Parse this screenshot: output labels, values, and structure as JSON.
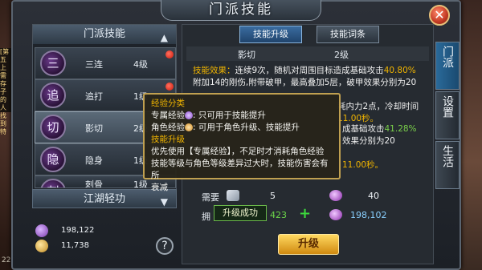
{
  "window": {
    "title": "门派技能",
    "close_label": "✕"
  },
  "left": {
    "header": "门派技能",
    "skills": [
      {
        "icon": "三",
        "name": "三连",
        "level": "4级",
        "red_dot": true
      },
      {
        "icon": "追",
        "name": "追打",
        "level": "1级",
        "red_dot": true
      },
      {
        "icon": "切",
        "name": "影切",
        "level": "2级",
        "red_dot": false,
        "selected": true
      },
      {
        "icon": "隐",
        "name": "隐身",
        "level": "1级",
        "red_dot": false
      },
      {
        "icon": "刺",
        "name": "刺骨",
        "level": "1级",
        "red_dot": false
      }
    ],
    "footer": "江湖轻功",
    "currencies": [
      {
        "value": "198,122"
      },
      {
        "value": "11,738"
      }
    ],
    "help_label": "?"
  },
  "tabs": [
    {
      "label": "技能升级",
      "active": true
    },
    {
      "label": "技能词条",
      "active": false
    }
  ],
  "info": {
    "skill_name": "影切",
    "skill_level": "2级"
  },
  "desc": {
    "l1_a": "技能效果：",
    "l1_b": "连续9次，随机对周围目标造成基础攻击",
    "l1_c": "40.80%",
    "l2": "附加14的刚伤,附带破甲，最高叠加5层，破甲效果分别为20",
    "l3_tail": "耗内力2点，冷却时间",
    "l3_val": "11.00秒。",
    "l4_tail": "成基础攻击",
    "l4_val": "41.28%",
    "l5_tail": "效果分别为20",
    "l6_tail": "11.00秒。"
  },
  "tooltip": {
    "h1": "经验分类",
    "r1a": "专属经验",
    "r1b": ": 只可用于技能提升",
    "r2a": "角色经验",
    "r2b": ": 可用于角色升级、技能提升",
    "h2": "技能升级",
    "p1": "优先使用【专属经验】，不足时才消耗角色经验",
    "p2": "技能等级与角色等级差异过大时，技能伤害会有所",
    "p3": "衰减"
  },
  "cost": {
    "need_label": "需要",
    "need_silver": "5",
    "need_exp": "40",
    "have_label": "拥",
    "have_silver": "423",
    "have_exp": "198,102",
    "plus": "+",
    "toast": "升级成功"
  },
  "upgrade_label": "升级",
  "side_tabs": [
    {
      "label": "门派",
      "active": true
    },
    {
      "label": "设置",
      "active": false
    },
    {
      "label": "生活",
      "active": false
    }
  ],
  "background_fragments": [
    "[第五",
    "上需存",
    "子的人",
    "找到特"
  ],
  "corner_level": "22"
}
